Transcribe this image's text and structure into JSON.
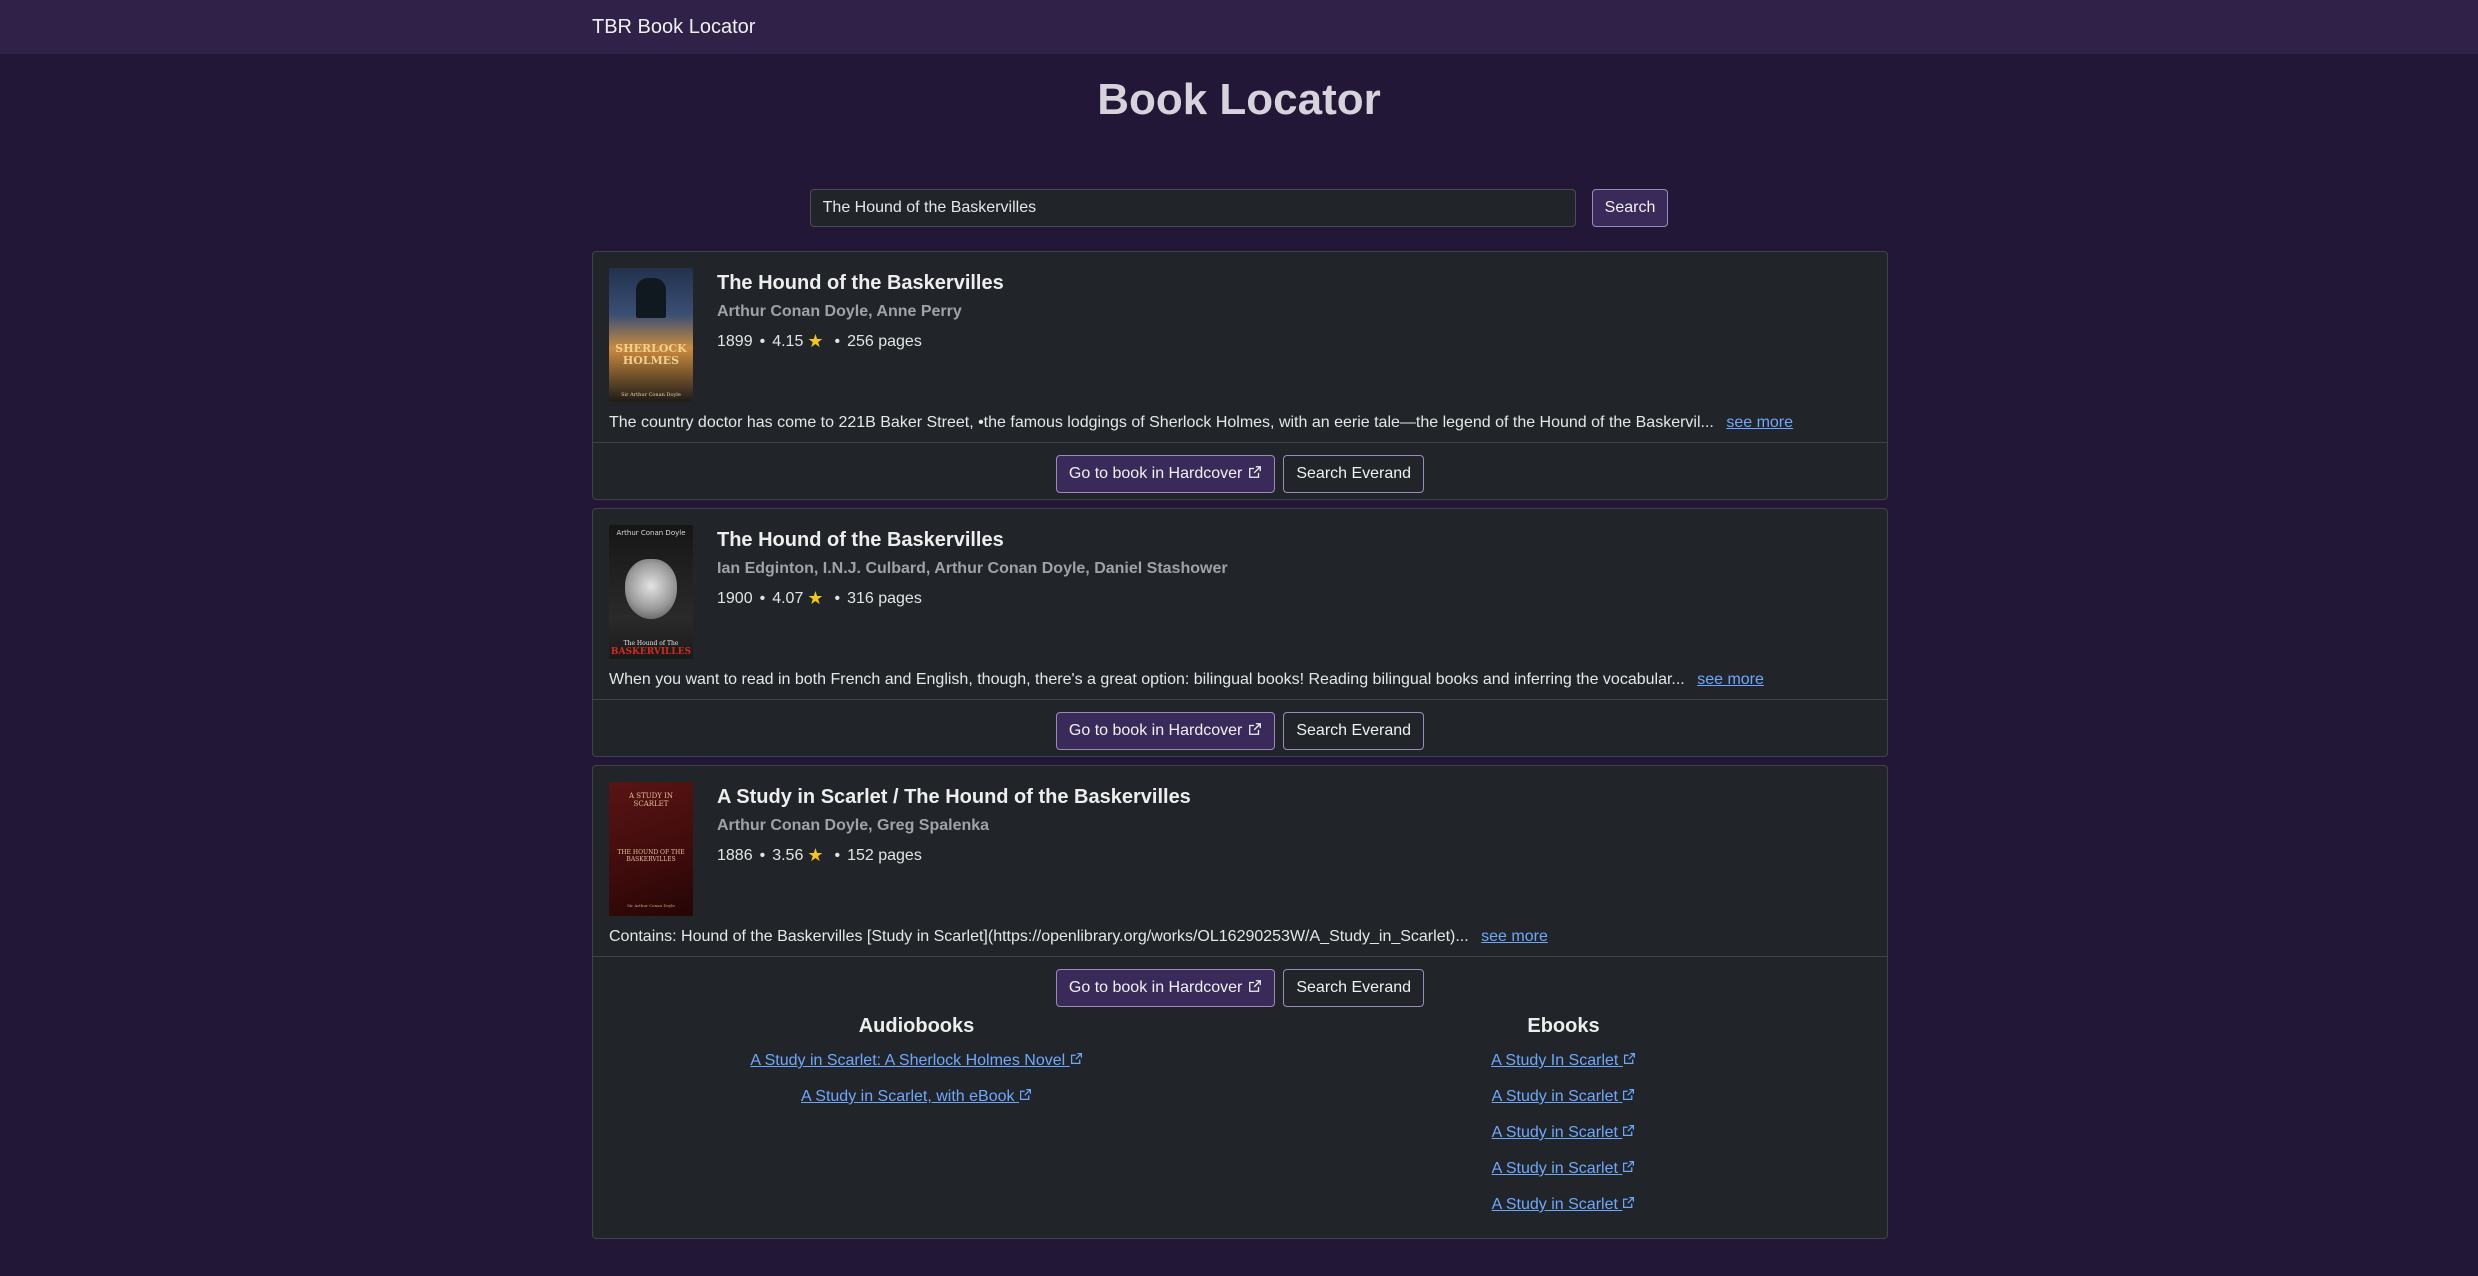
{
  "navbar": {
    "brand": "TBR Book Locator"
  },
  "page": {
    "title": "Book Locator"
  },
  "search": {
    "value": "The Hound of the Baskervilles",
    "button": "Search"
  },
  "actions": {
    "hardcover": "Go to book in Hardcover",
    "everand": "Search Everand",
    "see_more": "see more"
  },
  "books": [
    {
      "title": "The Hound of the Baskervilles",
      "authors": "Arthur Conan Doyle, Anne Perry",
      "year": "1899",
      "rating": "4.15",
      "pages": "256 pages",
      "description": "The country doctor has come to 221B Baker Street, •the famous lodgings of Sherlock Holmes, with an eerie tale—the legend of the Hound of the Baskervil...",
      "cover": {
        "colors": [
          "#2a3a55",
          "#e6b96a",
          "#1a1a1a"
        ],
        "text_top": "",
        "text_mid": "SHERLOCK HOLMES",
        "text_bottom": "Sir Arthur Conan Doyle"
      }
    },
    {
      "title": "The Hound of the Baskervilles",
      "authors": "Ian Edginton, I.N.J. Culbard, Arthur Conan Doyle, Daniel Stashower",
      "year": "1900",
      "rating": "4.07",
      "pages": "316 pages",
      "description": "When you want to read in both French and English, though, there's a great option: bilingual books! Reading bilingual books and inferring the vocabular...",
      "cover": {
        "colors": [
          "#1b1b1b",
          "#c9c9c9",
          "#c0261c"
        ],
        "text_top": "Arthur Conan Doyle",
        "text_mid": "The Hound of The",
        "text_bottom": "BASKERVILLES"
      }
    },
    {
      "title": "A Study in Scarlet / The Hound of the Baskervilles",
      "authors": "Arthur Conan Doyle, Greg Spalenka",
      "year": "1886",
      "rating": "3.56",
      "pages": "152 pages",
      "description": "Contains: Hound of the Baskervilles [Study in Scarlet](https://openlibrary.org/works/OL16290253W/A_Study_in_Scarlet)...",
      "cover": {
        "colors": [
          "#4a0e0e",
          "#d9b28a",
          "#2a0606"
        ],
        "text_top": "A STUDY IN SCARLET",
        "text_mid": "THE HOUND OF THE BASKERVILLES",
        "text_bottom": "Sir Arthur Conan Doyle"
      }
    }
  ],
  "formats": {
    "audiobooks": {
      "heading": "Audiobooks",
      "items": [
        "A Study in Scarlet: A Sherlock Holmes Novel",
        "A Study in Scarlet, with eBook"
      ]
    },
    "ebooks": {
      "heading": "Ebooks",
      "items": [
        "A Study In Scarlet",
        "A Study in Scarlet",
        "A Study in Scarlet",
        "A Study in Scarlet",
        "A Study in Scarlet"
      ]
    }
  }
}
